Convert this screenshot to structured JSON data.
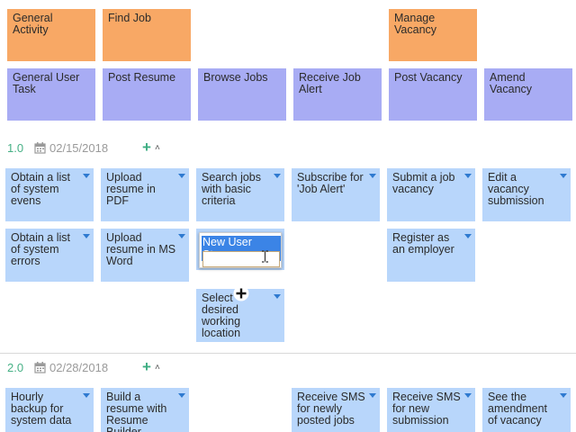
{
  "activities": [
    {
      "label": "General Activity"
    },
    {
      "label": "Find Job"
    },
    {
      "label": "Manage Vacancy"
    }
  ],
  "tasks": [
    {
      "label": "General User Task"
    },
    {
      "label": "Post Resume"
    },
    {
      "label": "Browse Jobs"
    },
    {
      "label": "Receive Job Alert"
    },
    {
      "label": "Post Vacancy"
    },
    {
      "label": "Amend Vacancy"
    }
  ],
  "releases": [
    {
      "version": "1.0",
      "date": "02/15/2018",
      "stories": [
        "Obtain a list of system evens",
        "Upload resume in PDF",
        "Search jobs with basic criteria",
        "Subscribe for 'Job Alert'",
        "Submit a job vacancy",
        "Edit a vacancy submission",
        "Obtain a list of system errors",
        "Upload resume in MS Word",
        "Register as an employer",
        "Select desired working location"
      ]
    },
    {
      "version": "2.0",
      "date": "02/28/2018",
      "stories": [
        "Hourly backup for system data",
        "Build a resume with Resume Builder",
        "Receive SMS for newly posted jobs",
        "Receive SMS for new submission",
        "See the amendment of vacancy"
      ]
    }
  ],
  "editor": {
    "value": "New User Story"
  },
  "colors": {
    "activity": "#f8a865",
    "task": "#a8acf4",
    "story": "#b8d6fb",
    "version": "#46b085",
    "selection": "#3b84e6"
  }
}
